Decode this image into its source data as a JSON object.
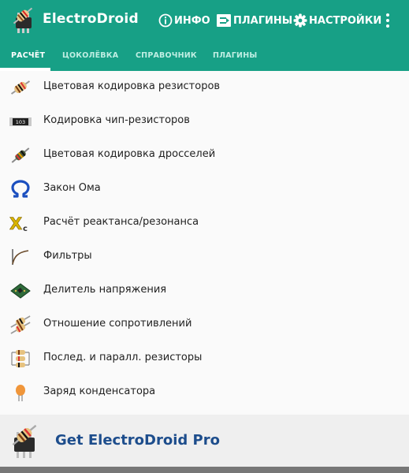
{
  "app": {
    "title": "ElectroDroid"
  },
  "actions": {
    "info": "ИНФО",
    "plugins": "ПЛАГИНЫ",
    "settings": "НАСТРОЙКИ"
  },
  "tabs": [
    "РАСЧЁТ",
    "ЦОКОЛЁВКА",
    "СПРАВОЧНИК",
    "ПЛАГИНЫ"
  ],
  "chip_label": "103",
  "items": [
    {
      "label": "Цветовая кодировка резисторов",
      "icon": "resistor-icon"
    },
    {
      "label": "Кодировка чип-резисторов",
      "icon": "chip-resistor-icon"
    },
    {
      "label": "Цветовая кодировка дросселей",
      "icon": "inductor-icon"
    },
    {
      "label": "Закон Ома",
      "icon": "omega-icon"
    },
    {
      "label": "Расчёт реактанса/резонанса",
      "icon": "reactance-icon"
    },
    {
      "label": "Фильтры",
      "icon": "filter-curve-icon"
    },
    {
      "label": "Делитель напряжения",
      "icon": "circuit-board-icon"
    },
    {
      "label": "Отношение сопротивлений",
      "icon": "resistor-pair-icon"
    },
    {
      "label": "Послед. и паралл. резисторы",
      "icon": "series-parallel-icon"
    },
    {
      "label": "Заряд конденсатора",
      "icon": "capacitor-icon"
    }
  ],
  "reactance_letters": {
    "main": "X",
    "sub": "c"
  },
  "promo": {
    "text": "Get ElectroDroid Pro"
  },
  "colors": {
    "primary": "#17a086",
    "promo_text": "#1d4d8c"
  }
}
